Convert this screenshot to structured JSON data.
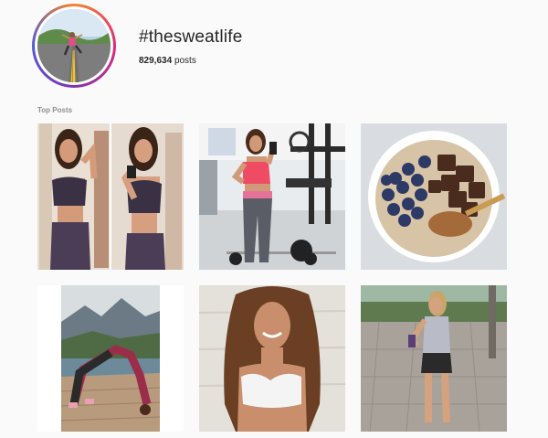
{
  "page": {
    "hashtag": "#thesweatlife",
    "post_count": "829,634",
    "post_count_label": "posts",
    "section_title": "Top Posts"
  },
  "posts": [
    {
      "alt": "Two mirror selfies in a bedroom, purple crop top and leggings"
    },
    {
      "alt": "Gym mirror selfie, pink sports bra and grey leggings"
    },
    {
      "alt": "Oatmeal bowl with blueberries, brownie chunks and nut butter"
    },
    {
      "alt": "Yoga pose on wooden deck with mountain lake behind"
    },
    {
      "alt": "Smiling woman with curly hair in white sports bra"
    },
    {
      "alt": "Woman in grey tee and black shorts on stone patio"
    }
  ],
  "colors": {
    "ring_start": "#f58529",
    "ring_end": "#515bd4",
    "label_grey": "#8e8e8e",
    "background": "#fafafa"
  }
}
